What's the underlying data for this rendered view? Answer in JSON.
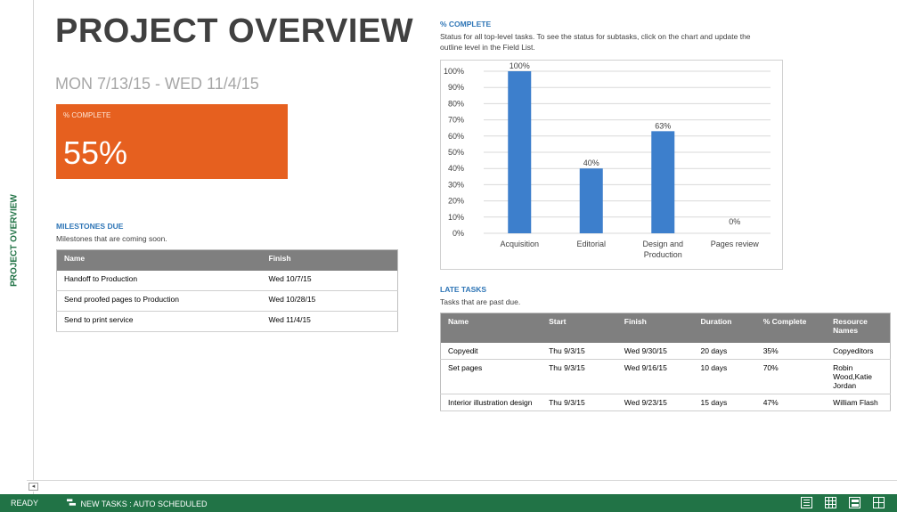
{
  "side_label": "PROJECT OVERVIEW",
  "title": "PROJECT OVERVIEW",
  "date_range": "MON 7/13/15 -   WED 11/4/15",
  "percent_card": {
    "label": "% COMPLETE",
    "value": "55%",
    "color": "#e6601f"
  },
  "milestones": {
    "title": "MILESTONES DUE",
    "subtitle": "Milestones that are coming soon.",
    "columns": [
      "Name",
      "Finish"
    ],
    "rows": [
      [
        "Handoff to Production",
        "Wed 10/7/15"
      ],
      [
        "Send proofed pages to Production",
        "Wed 10/28/15"
      ],
      [
        "Send to print service",
        "Wed 11/4/15"
      ]
    ]
  },
  "chart_section": {
    "title": "% COMPLETE",
    "subtitle_line1": "Status for all top-level tasks. To see the status for subtasks, click on the chart and update the",
    "subtitle_line2": "outline level in the Field List."
  },
  "chart_data": {
    "type": "bar",
    "categories": [
      [
        "Acquisition"
      ],
      [
        "Editorial"
      ],
      [
        "Design and",
        "Production"
      ],
      [
        "Pages review"
      ]
    ],
    "values": [
      100,
      40,
      63,
      0
    ],
    "data_labels": [
      "100%",
      "40%",
      "63%",
      "0%"
    ],
    "yticks": [
      "0%",
      "10%",
      "20%",
      "30%",
      "40%",
      "50%",
      "60%",
      "70%",
      "80%",
      "90%",
      "100%"
    ],
    "ylim": [
      0,
      100
    ],
    "grid": true,
    "bar_color": "#3d7fcc"
  },
  "late_tasks": {
    "title": "LATE TASKS",
    "subtitle": "Tasks that are past due.",
    "columns": [
      "Name",
      "Start",
      "Finish",
      "Duration",
      "% Complete",
      "Resource Names"
    ],
    "rows": [
      [
        "Copyedit",
        "Thu 9/3/15",
        "Wed 9/30/15",
        "20 days",
        "35%",
        "Copyeditors"
      ],
      [
        "Set pages",
        "Thu 9/3/15",
        "Wed 9/16/15",
        "10 days",
        "70%",
        "Robin Wood,Katie Jordan"
      ],
      [
        "Interior illustration design",
        "Thu 9/3/15",
        "Wed 9/23/15",
        "15 days",
        "47%",
        "William Flash"
      ]
    ]
  },
  "scroll_left": "◂",
  "status": {
    "ready": "READY",
    "tasks_mode": "NEW TASKS : AUTO SCHEDULED",
    "accent": "#217346"
  }
}
